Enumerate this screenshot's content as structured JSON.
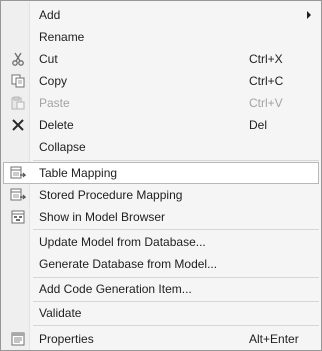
{
  "menu": {
    "items": [
      {
        "label": "Add",
        "shortcut": "",
        "submenu": true
      },
      {
        "label": "Rename",
        "shortcut": ""
      },
      {
        "label": "Cut",
        "shortcut": "Ctrl+X",
        "icon": "scissors-icon"
      },
      {
        "label": "Copy",
        "shortcut": "Ctrl+C",
        "icon": "copy-icon"
      },
      {
        "label": "Paste",
        "shortcut": "Ctrl+V",
        "icon": "paste-icon",
        "disabled": true
      },
      {
        "label": "Delete",
        "shortcut": "Del",
        "icon": "delete-x-icon"
      },
      {
        "label": "Collapse",
        "shortcut": ""
      },
      {
        "label": "Table Mapping",
        "shortcut": "",
        "icon": "table-mapping-icon",
        "selected": true
      },
      {
        "label": "Stored Procedure Mapping",
        "shortcut": "",
        "icon": "stored-procedure-icon"
      },
      {
        "label": "Show in Model Browser",
        "shortcut": "",
        "icon": "model-browser-icon"
      },
      {
        "label": "Update Model from Database...",
        "shortcut": ""
      },
      {
        "label": "Generate Database from Model...",
        "shortcut": ""
      },
      {
        "label": "Add Code Generation Item...",
        "shortcut": ""
      },
      {
        "label": "Validate",
        "shortcut": ""
      },
      {
        "label": "Properties",
        "shortcut": "Alt+Enter",
        "icon": "properties-icon"
      }
    ]
  }
}
